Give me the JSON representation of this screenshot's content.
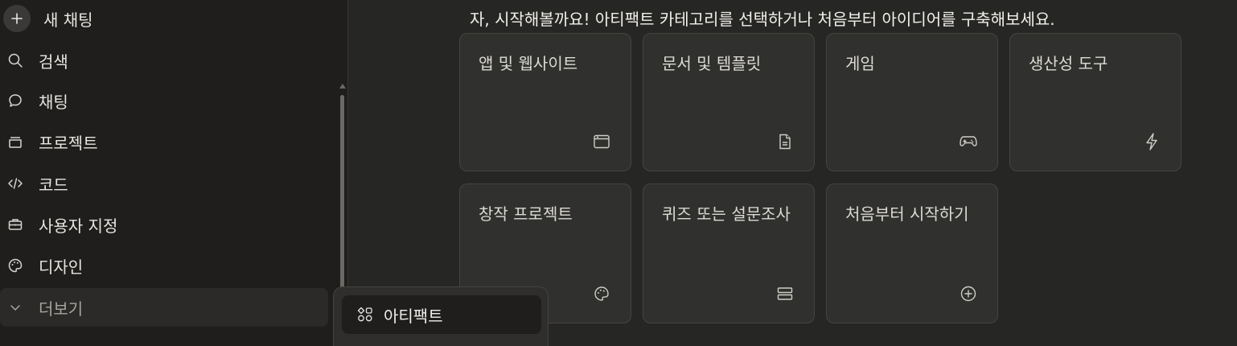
{
  "sidebar": {
    "new_chat": {
      "label": "새 채팅",
      "icon": "plus-icon"
    },
    "items": [
      {
        "label": "검색",
        "icon": "search-icon"
      },
      {
        "label": "채팅",
        "icon": "chat-bubble-icon"
      },
      {
        "label": "프로젝트",
        "icon": "folder-icon"
      },
      {
        "label": "코드",
        "icon": "code-icon"
      },
      {
        "label": "사용자 지정",
        "icon": "toolbox-icon"
      },
      {
        "label": "디자인",
        "icon": "palette-icon"
      },
      {
        "label": "더보기",
        "icon": "chevron-down-icon"
      }
    ]
  },
  "popup": {
    "items": [
      {
        "label": "아티팩트",
        "icon": "artifacts-icon"
      }
    ]
  },
  "main": {
    "heading": "자, 시작해볼까요! 아티팩트 카테고리를 선택하거나 처음부터 아이디어를 구축해보세요.",
    "cards": [
      {
        "title": "앱 및 웹사이트",
        "icon": "browser-window-icon"
      },
      {
        "title": "문서 및 템플릿",
        "icon": "document-icon"
      },
      {
        "title": "게임",
        "icon": "gamepad-icon"
      },
      {
        "title": "생산성 도구",
        "icon": "lightning-icon"
      },
      {
        "title": "창작 프로젝트",
        "icon": "palette-icon"
      },
      {
        "title": "퀴즈 또는 설문조사",
        "icon": "form-icon"
      },
      {
        "title": "처음부터 시작하기",
        "icon": "plus-circle-icon"
      }
    ]
  },
  "colors": {
    "background": "#262624",
    "sidebar": "#1f1e1d",
    "card": "#30302e",
    "text": "#e8e6e1"
  }
}
